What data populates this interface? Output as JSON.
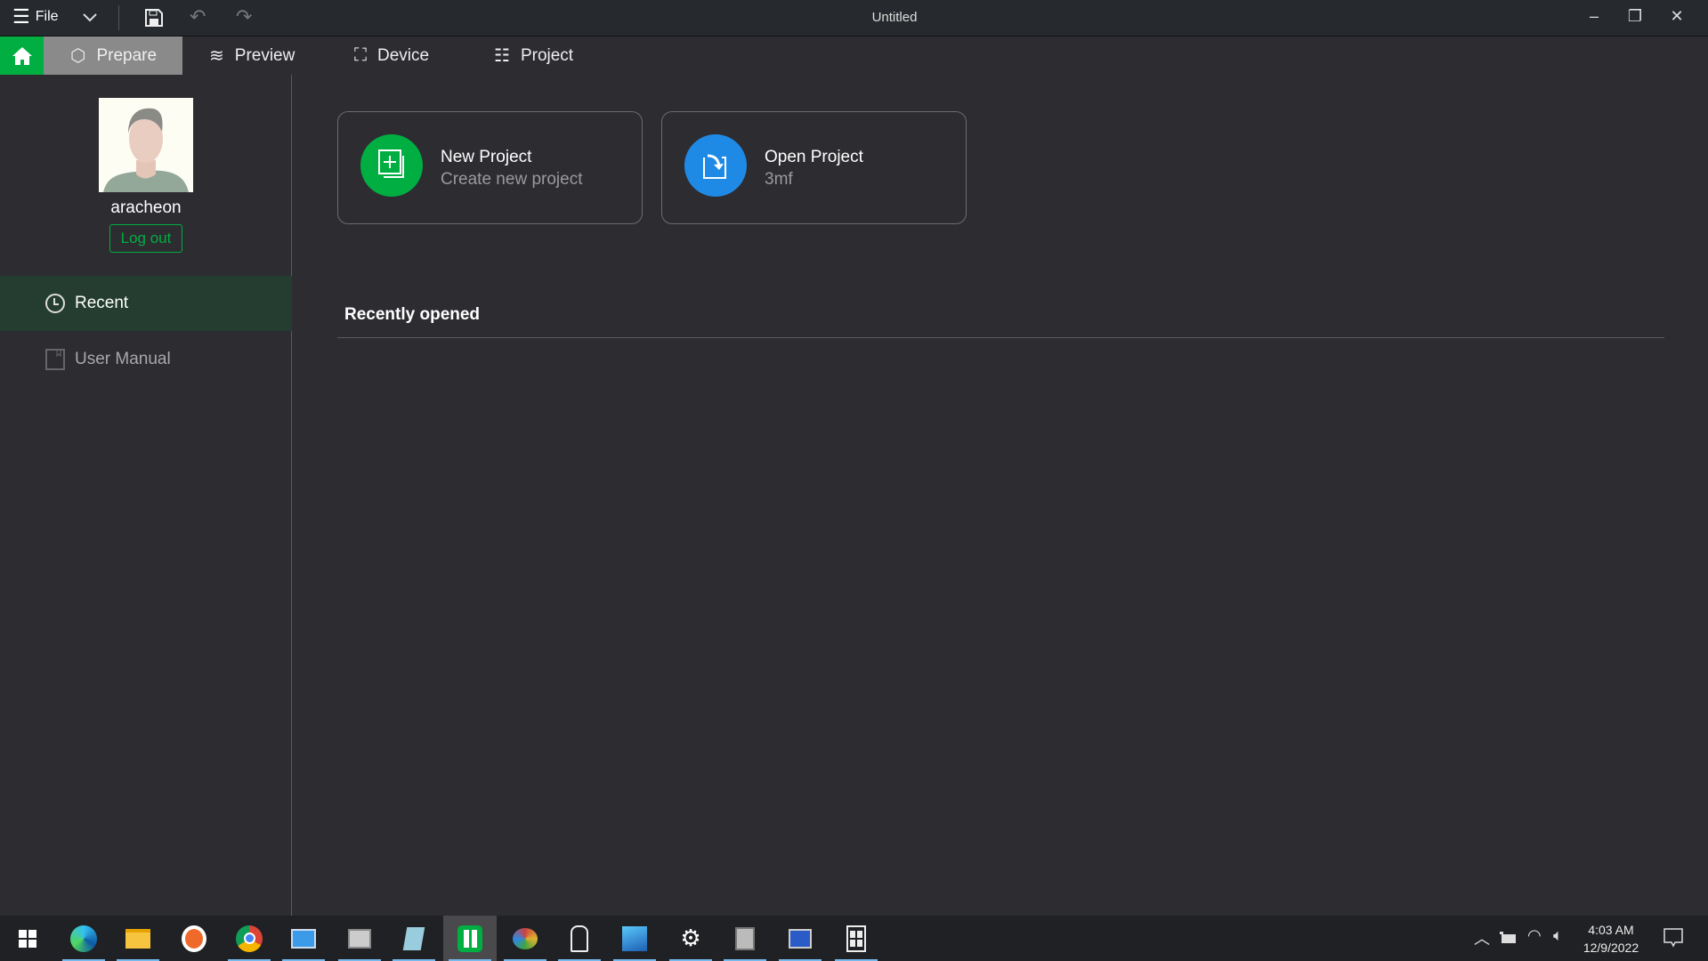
{
  "titlebar": {
    "file_label": "File",
    "title": "Untitled"
  },
  "tabs": [
    {
      "label": "Prepare",
      "active": true
    },
    {
      "label": "Preview"
    },
    {
      "label": "Device"
    },
    {
      "label": "Project"
    }
  ],
  "sidebar": {
    "username": "aracheon",
    "logout_label": "Log out",
    "items": [
      {
        "label": "Recent",
        "active": true
      },
      {
        "label": "User Manual"
      }
    ]
  },
  "cards": {
    "new": {
      "title": "New Project",
      "subtitle": "Create new project"
    },
    "open": {
      "title": "Open Project",
      "subtitle": "3mf"
    }
  },
  "recent": {
    "heading": "Recently opened"
  },
  "colors": {
    "accent": "#00ae42",
    "blue": "#1e8ae6",
    "active_row": "#243d30"
  },
  "taskbar": {
    "time": "4:03 AM",
    "date": "12/9/2022",
    "apps": [
      "start",
      "edge",
      "file-explorer",
      "app-orange",
      "chrome",
      "control-panel",
      "resource-monitor",
      "notepad",
      "bambu-studio",
      "paint",
      "user-app",
      "photos",
      "settings",
      "device-app",
      "remote-desktop",
      "calculator-app"
    ]
  }
}
